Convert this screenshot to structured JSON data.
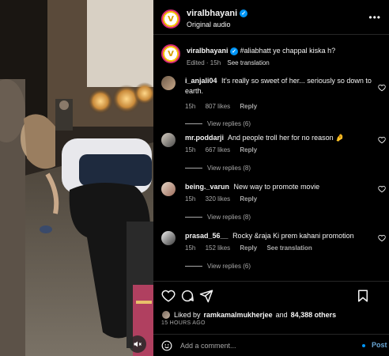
{
  "header": {
    "username": "viralbhayani",
    "subtitle": "Original audio",
    "more_icon": "more-horizontal-icon"
  },
  "caption": {
    "username": "viralbhayani",
    "text": "#aliabhatt ye chappal kiska h?",
    "meta": "Edited · 15h",
    "see_translation": "See translation"
  },
  "comments": [
    {
      "username": "i_anjali04",
      "text": "It's really so sweet of her... seriously so down to earth.",
      "time": "15h",
      "likes": "807 likes",
      "reply": "Reply",
      "view_replies": "View replies (6)"
    },
    {
      "username": "mr.poddarji",
      "text": "And people troll her for no reason 🤌",
      "time": "15h",
      "likes": "667 likes",
      "reply": "Reply",
      "view_replies": "View replies (8)"
    },
    {
      "username": "being._varun",
      "text": "New way to promote movie",
      "time": "15h",
      "likes": "320 likes",
      "reply": "Reply",
      "view_replies": "View replies (8)"
    },
    {
      "username": "prasad_56__",
      "text": "Rocky &raja Ki prem kahani promotion",
      "time": "15h",
      "likes": "152 likes",
      "reply": "Reply",
      "see_translation": "See translation",
      "view_replies": "View replies (6)"
    }
  ],
  "actions": {
    "icons": [
      "heart-icon",
      "comment-icon",
      "share-icon",
      "save-icon"
    ]
  },
  "likes": {
    "prefix": "Liked by",
    "user": "ramkamalmukherjee",
    "middle": "and",
    "count": "84,388 others"
  },
  "timeago": "15 HOURS AGO",
  "add_comment": {
    "placeholder": "Add a comment...",
    "post_label": "Post"
  },
  "colors": {
    "background": "#000000",
    "accent": "#0095f6",
    "muted": "#a8a8a8",
    "divider": "#262626"
  }
}
